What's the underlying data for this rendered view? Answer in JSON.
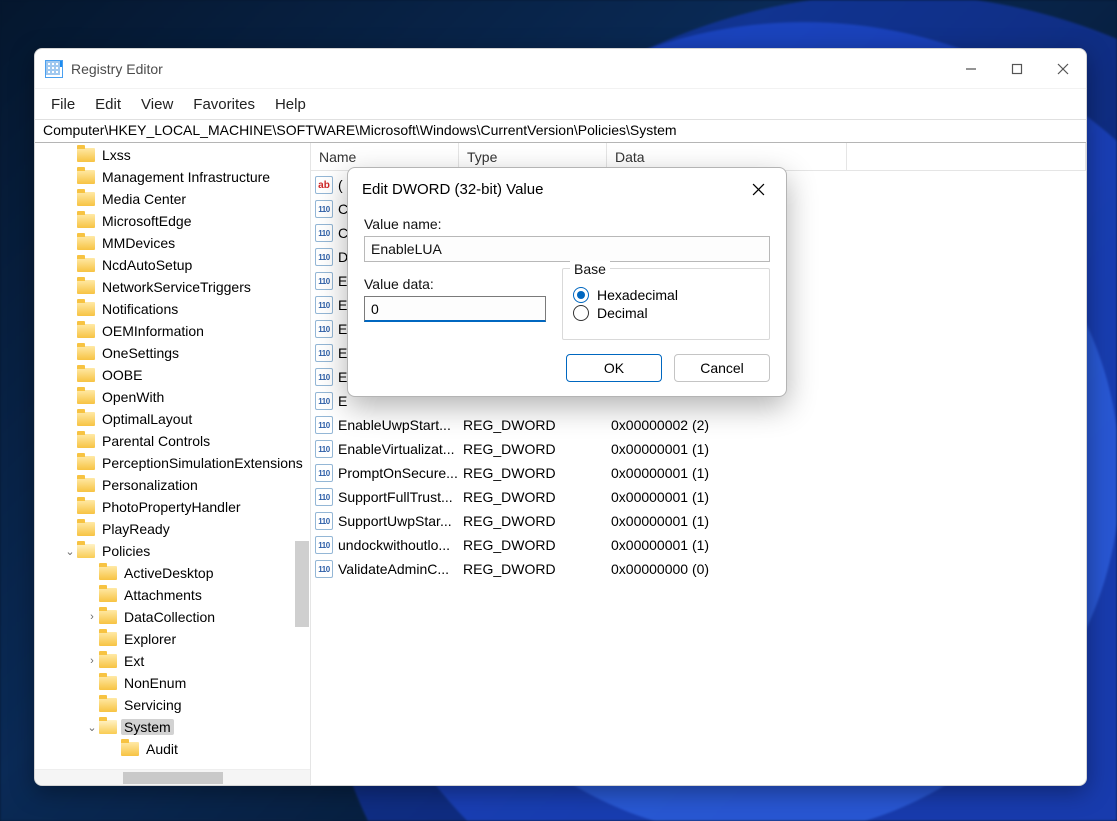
{
  "app_title": "Registry Editor",
  "menus": [
    "File",
    "Edit",
    "View",
    "Favorites",
    "Help"
  ],
  "address": "Computer\\HKEY_LOCAL_MACHINE\\SOFTWARE\\Microsoft\\Windows\\CurrentVersion\\Policies\\System",
  "tree": [
    {
      "label": "Lxss",
      "indent": 1,
      "chev": "",
      "open": false
    },
    {
      "label": "Management Infrastructure",
      "indent": 1,
      "chev": "",
      "open": false
    },
    {
      "label": "Media Center",
      "indent": 1,
      "chev": "",
      "open": false
    },
    {
      "label": "MicrosoftEdge",
      "indent": 1,
      "chev": "",
      "open": false
    },
    {
      "label": "MMDevices",
      "indent": 1,
      "chev": "",
      "open": false
    },
    {
      "label": "NcdAutoSetup",
      "indent": 1,
      "chev": "",
      "open": false
    },
    {
      "label": "NetworkServiceTriggers",
      "indent": 1,
      "chev": "",
      "open": false
    },
    {
      "label": "Notifications",
      "indent": 1,
      "chev": "",
      "open": false
    },
    {
      "label": "OEMInformation",
      "indent": 1,
      "chev": "",
      "open": false
    },
    {
      "label": "OneSettings",
      "indent": 1,
      "chev": "",
      "open": false
    },
    {
      "label": "OOBE",
      "indent": 1,
      "chev": "",
      "open": false
    },
    {
      "label": "OpenWith",
      "indent": 1,
      "chev": "",
      "open": false
    },
    {
      "label": "OptimalLayout",
      "indent": 1,
      "chev": "",
      "open": false
    },
    {
      "label": "Parental Controls",
      "indent": 1,
      "chev": "",
      "open": false
    },
    {
      "label": "PerceptionSimulationExtensions",
      "indent": 1,
      "chev": "",
      "open": false
    },
    {
      "label": "Personalization",
      "indent": 1,
      "chev": "",
      "open": false
    },
    {
      "label": "PhotoPropertyHandler",
      "indent": 1,
      "chev": "",
      "open": false
    },
    {
      "label": "PlayReady",
      "indent": 1,
      "chev": "",
      "open": false
    },
    {
      "label": "Policies",
      "indent": 1,
      "chev": "v",
      "open": true
    },
    {
      "label": "ActiveDesktop",
      "indent": 2,
      "chev": "",
      "open": false
    },
    {
      "label": "Attachments",
      "indent": 2,
      "chev": "",
      "open": false
    },
    {
      "label": "DataCollection",
      "indent": 2,
      "chev": ">",
      "open": false
    },
    {
      "label": "Explorer",
      "indent": 2,
      "chev": "",
      "open": false
    },
    {
      "label": "Ext",
      "indent": 2,
      "chev": ">",
      "open": false
    },
    {
      "label": "NonEnum",
      "indent": 2,
      "chev": "",
      "open": false
    },
    {
      "label": "Servicing",
      "indent": 2,
      "chev": "",
      "open": false
    },
    {
      "label": "System",
      "indent": 2,
      "chev": "v",
      "open": true,
      "selected": true
    },
    {
      "label": "Audit",
      "indent": 3,
      "chev": "",
      "open": false
    }
  ],
  "list_headers": {
    "name": "Name",
    "type": "Type",
    "data": "Data"
  },
  "values": [
    {
      "name": "(Default)",
      "nameDisp": "(",
      "type": "",
      "data": "",
      "icon": "str"
    },
    {
      "name": "C",
      "nameDisp": "C",
      "type": "",
      "data": "",
      "icon": "bin"
    },
    {
      "name": "C",
      "nameDisp": "C",
      "type": "",
      "data": "",
      "icon": "bin"
    },
    {
      "name": "D",
      "nameDisp": "D",
      "type": "",
      "data": "",
      "icon": "bin"
    },
    {
      "name": "E",
      "nameDisp": "E",
      "type": "",
      "data": "",
      "icon": "bin"
    },
    {
      "name": "E",
      "nameDisp": "E",
      "type": "",
      "data": "",
      "icon": "bin"
    },
    {
      "name": "E",
      "nameDisp": "E",
      "type": "",
      "data": "",
      "icon": "bin"
    },
    {
      "name": "E",
      "nameDisp": "E",
      "type": "",
      "data": "",
      "icon": "bin"
    },
    {
      "name": "E",
      "nameDisp": "E",
      "type": "",
      "data": "",
      "icon": "bin"
    },
    {
      "name": "E",
      "nameDisp": "E",
      "type": "",
      "data": "",
      "icon": "bin"
    },
    {
      "name": "EnableUwpStart...",
      "nameDisp": "EnableUwpStart...",
      "type": "REG_DWORD",
      "data": "0x00000002 (2)",
      "icon": "bin"
    },
    {
      "name": "EnableVirtualizat...",
      "nameDisp": "EnableVirtualizat...",
      "type": "REG_DWORD",
      "data": "0x00000001 (1)",
      "icon": "bin"
    },
    {
      "name": "PromptOnSecure...",
      "nameDisp": "PromptOnSecure...",
      "type": "REG_DWORD",
      "data": "0x00000001 (1)",
      "icon": "bin"
    },
    {
      "name": "SupportFullTrust...",
      "nameDisp": "SupportFullTrust...",
      "type": "REG_DWORD",
      "data": "0x00000001 (1)",
      "icon": "bin"
    },
    {
      "name": "SupportUwpStar...",
      "nameDisp": "SupportUwpStar...",
      "type": "REG_DWORD",
      "data": "0x00000001 (1)",
      "icon": "bin"
    },
    {
      "name": "undockwithoutlo...",
      "nameDisp": "undockwithoutlo...",
      "type": "REG_DWORD",
      "data": "0x00000001 (1)",
      "icon": "bin"
    },
    {
      "name": "ValidateAdminC...",
      "nameDisp": "ValidateAdminC...",
      "type": "REG_DWORD",
      "data": "0x00000000 (0)",
      "icon": "bin"
    }
  ],
  "dialog": {
    "title": "Edit DWORD (32-bit) Value",
    "value_name_label": "Value name:",
    "value_name": "EnableLUA",
    "value_data_label": "Value data:",
    "value_data": "0",
    "base_label": "Base",
    "hex_label": "Hexadecimal",
    "dec_label": "Decimal",
    "base_selected": "hex",
    "ok": "OK",
    "cancel": "Cancel"
  }
}
